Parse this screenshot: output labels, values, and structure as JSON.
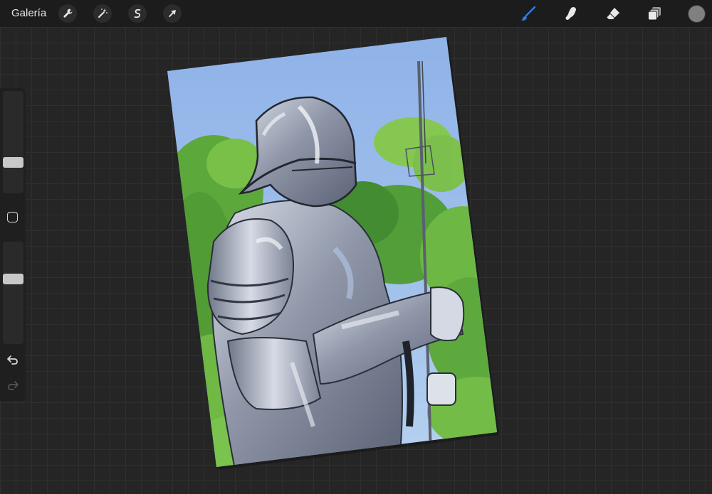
{
  "topbar": {
    "gallery_label": "Galería",
    "left_tools": [
      {
        "name": "actions",
        "icon": "wrench-icon"
      },
      {
        "name": "adjustments",
        "icon": "magic-wand-icon"
      },
      {
        "name": "selection",
        "icon": "selection-s-icon"
      },
      {
        "name": "transform",
        "icon": "arrow-cursor-icon"
      }
    ],
    "right_tools": [
      {
        "name": "brush",
        "icon": "brush-icon",
        "active": true
      },
      {
        "name": "smudge",
        "icon": "smudge-finger-icon"
      },
      {
        "name": "eraser",
        "icon": "eraser-icon"
      },
      {
        "name": "layers",
        "icon": "layers-icon"
      }
    ],
    "current_color": "#808080",
    "accent_color": "#2b7de9"
  },
  "sidebar": {
    "brush_size_level": 0.28,
    "opacity_level": 0.65,
    "modify_icon": "square-modify-icon",
    "undo_icon": "undo-arrow-icon",
    "redo_icon": "redo-arrow-icon"
  }
}
